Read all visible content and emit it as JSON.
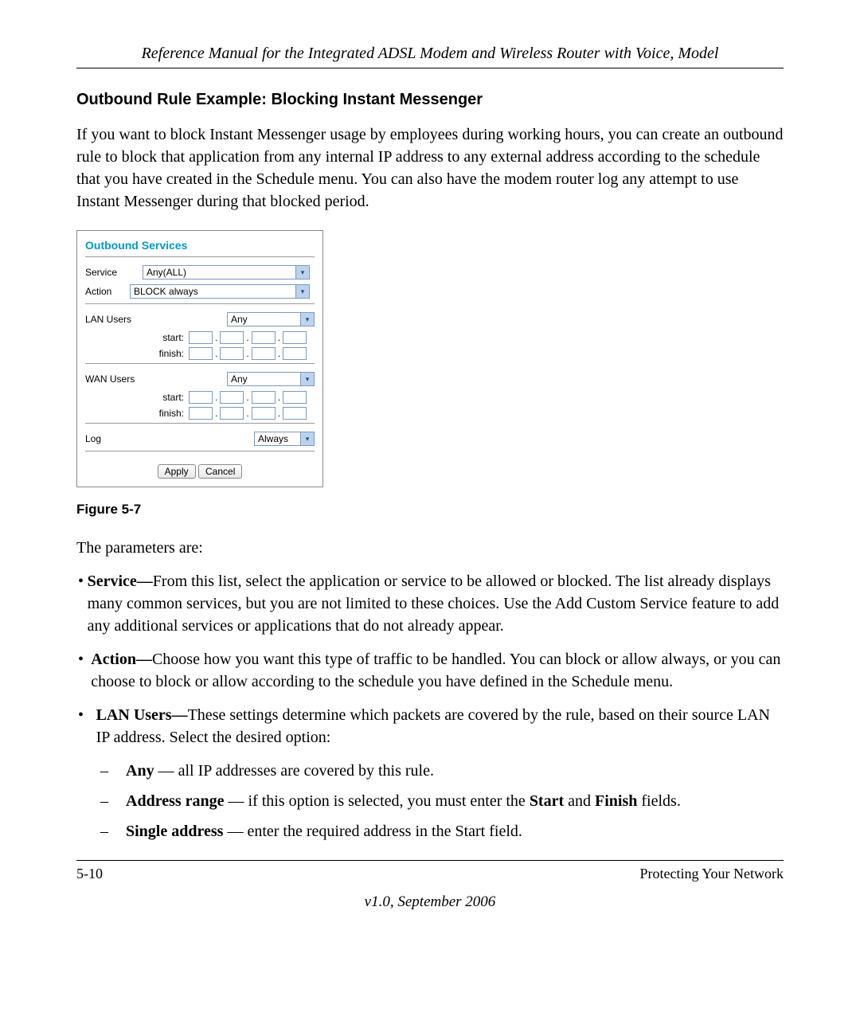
{
  "header": {
    "title": "Reference Manual for the Integrated ADSL Modem and Wireless Router with Voice, Model"
  },
  "section": {
    "heading": "Outbound Rule Example: Blocking Instant Messenger",
    "paragraph": "If you want to block Instant Messenger usage by employees during working hours, you can create an outbound rule to block that application from any internal IP address to any external address according to the schedule that you have created in the Schedule menu. You can also have the modem router log any attempt to use Instant Messenger during that blocked period."
  },
  "figure": {
    "title": "Outbound Services",
    "labels": {
      "service": "Service",
      "action": "Action",
      "lan_users": "LAN Users",
      "wan_users": "WAN Users",
      "start": "start:",
      "finish": "finish:",
      "log": "Log"
    },
    "values": {
      "service": "Any(ALL)",
      "action": "BLOCK always",
      "lan_users": "Any",
      "wan_users": "Any",
      "log": "Always"
    },
    "buttons": {
      "apply": "Apply",
      "cancel": "Cancel"
    },
    "caption": "Figure 5-7"
  },
  "params_intro": "The parameters are:",
  "bullets": {
    "service_label": "Service—",
    "service_text": "From this list, select the application or service to be allowed or blocked. The list already displays many common services, but you are not limited to these choices. Use the Add Custom Service feature to add any additional services or applications that do not already appear.",
    "action_label": "Action—",
    "action_text": "Choose how you want this type of traffic to be handled. You can block or allow always, or you can choose to block or allow according to the schedule you have defined in the Schedule menu.",
    "lan_label": "LAN Users—",
    "lan_text": "These settings determine which packets are covered by the rule, based on their source LAN IP address. Select the desired option:",
    "sub_any_label": "Any",
    "sub_any_text": " — all IP addresses are covered by this rule.",
    "sub_range_label": "Address range",
    "sub_range_text_a": " — if this option is selected, you must enter the ",
    "sub_range_start": "Start",
    "sub_range_text_b": " and ",
    "sub_range_finish": "Finish",
    "sub_range_text_c": " fields.",
    "sub_single_label": "Single address",
    "sub_single_text": " — enter the required address in the Start field."
  },
  "footer": {
    "page": "5-10",
    "chapter": "Protecting Your Network",
    "version": "v1.0, September 2006"
  }
}
